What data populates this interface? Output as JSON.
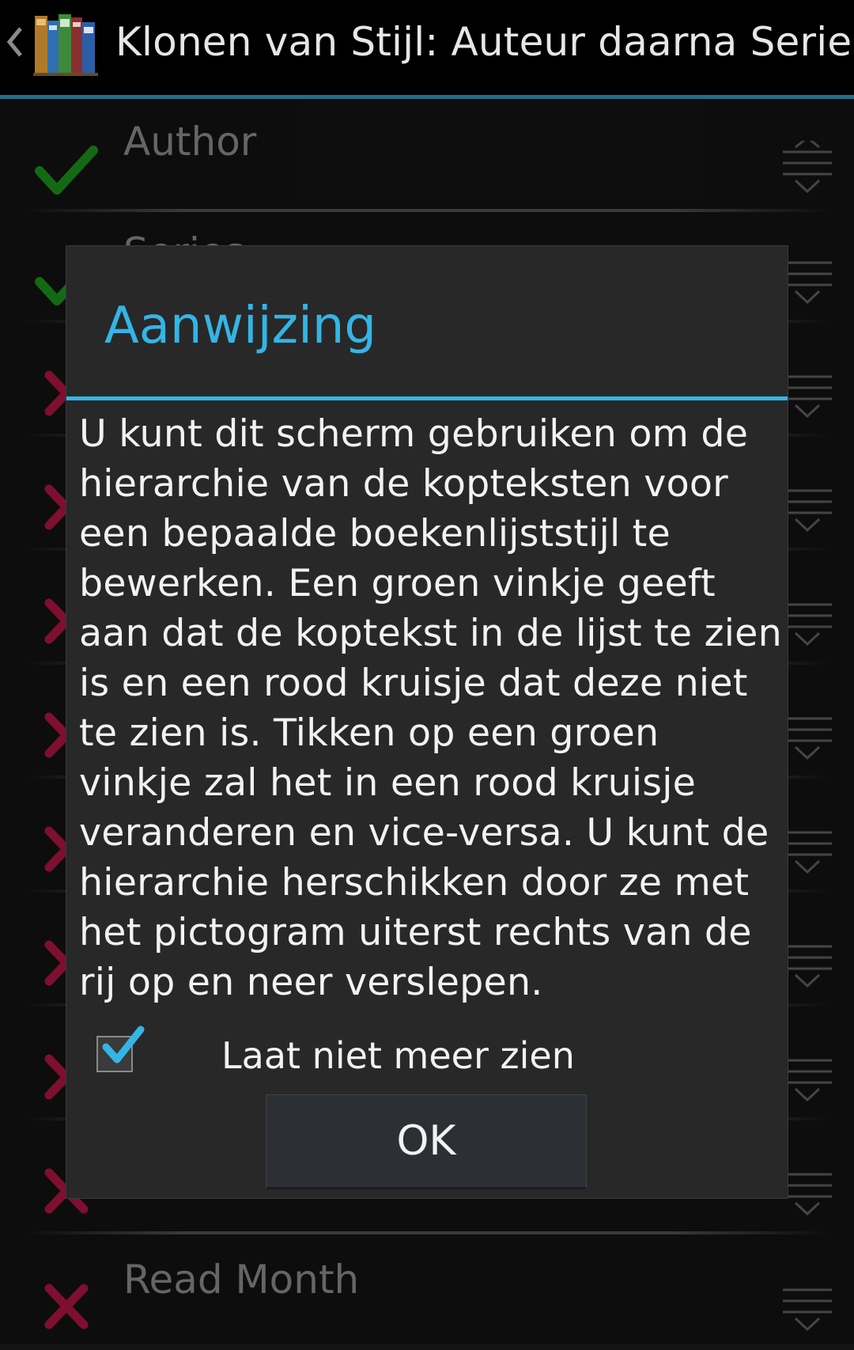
{
  "actionbar": {
    "title": "Klonen van Stijl: Auteur daarna Serie",
    "up_icon": "chevron-left-icon",
    "app_icon": "books-icon"
  },
  "list": {
    "rows": [
      {
        "label": "Author",
        "state": "visible",
        "icon": "green-checkmark-icon"
      },
      {
        "label": "Series",
        "state": "visible",
        "icon": "green-checkmark-icon"
      },
      {
        "label": "",
        "state": "hidden",
        "icon": "red-cross-icon"
      },
      {
        "label": "",
        "state": "hidden",
        "icon": "red-cross-icon"
      },
      {
        "label": "",
        "state": "hidden",
        "icon": "red-cross-icon"
      },
      {
        "label": "",
        "state": "hidden",
        "icon": "red-cross-icon"
      },
      {
        "label": "",
        "state": "hidden",
        "icon": "red-cross-icon"
      },
      {
        "label": "",
        "state": "hidden",
        "icon": "red-cross-icon"
      },
      {
        "label": "",
        "state": "hidden",
        "icon": "red-cross-icon"
      },
      {
        "label": "",
        "state": "hidden",
        "icon": "red-cross-icon"
      },
      {
        "label": "Read Month",
        "state": "hidden",
        "icon": "red-cross-icon"
      }
    ],
    "drag_icon": "drag-handle-icon"
  },
  "dialog": {
    "title": "Aanwijzing",
    "message": "U kunt dit scherm gebruiken om de hierarchie van de kopteksten voor een bepaalde boekenlijststijl te bewerken. Een groen vinkje geeft aan dat de koptekst in de lijst te zien is en een rood kruisje dat deze niet te zien is. Tikken op een groen vinkje zal het in een rood kruisje veranderen en vice-versa. U kunt de hierarchie herschikken door ze met het pictogram uiterst rechts van de rij op en neer verslepen.",
    "checkbox_label": "Laat niet meer zien",
    "checkbox_checked": true,
    "ok_label": "OK"
  },
  "colors": {
    "accent": "#33b5e5",
    "check_green": "#1fa31f",
    "cross_red": "#c2184c",
    "background": "#151515"
  }
}
